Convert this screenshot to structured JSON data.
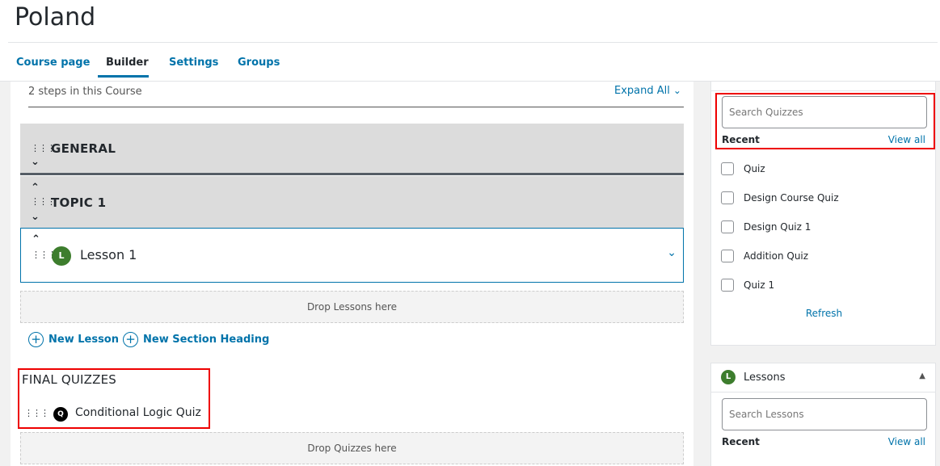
{
  "page": {
    "title": "Poland"
  },
  "tabs": [
    {
      "label": "Course page"
    },
    {
      "label": "Builder"
    },
    {
      "label": "Settings"
    },
    {
      "label": "Groups"
    }
  ],
  "builder": {
    "steps_count": "2 steps in this Course",
    "expand_all": "Expand All",
    "sections": [
      {
        "label": "GENERAL"
      },
      {
        "label": "TOPIC 1"
      }
    ],
    "lesson": {
      "badge": "L",
      "label": "Lesson 1"
    },
    "drop_lessons": "Drop Lessons here",
    "new_lesson": "New Lesson",
    "new_section_heading": "New Section Heading",
    "final_quizzes": {
      "title": "FINAL QUIZZES",
      "quiz_badge": "Q",
      "quiz_label": "Conditional Logic Quiz"
    },
    "drop_quizzes": "Drop Quizzes here"
  },
  "sidebar": {
    "quizzes": {
      "search_placeholder": "Search Quizzes",
      "recent_label": "Recent",
      "view_all": "View all",
      "items": [
        "Quiz",
        "Design Course Quiz",
        "Design Quiz 1",
        "Addition Quiz",
        "Quiz 1"
      ],
      "refresh": "Refresh"
    },
    "lessons": {
      "badge": "L",
      "title": "Lessons",
      "search_placeholder": "Search Lessons",
      "recent_label": "Recent",
      "view_all": "View all"
    }
  },
  "colors": {
    "accent": "#0073aa",
    "highlight": "#ee0000",
    "lesson_badge": "#3d7d2d"
  },
  "icons": [
    "drag-handle-icon",
    "chevron-down-icon",
    "chevron-up-icon",
    "plus-circle-icon",
    "caret-up-icon",
    "lesson-badge-icon",
    "quiz-badge-icon"
  ]
}
